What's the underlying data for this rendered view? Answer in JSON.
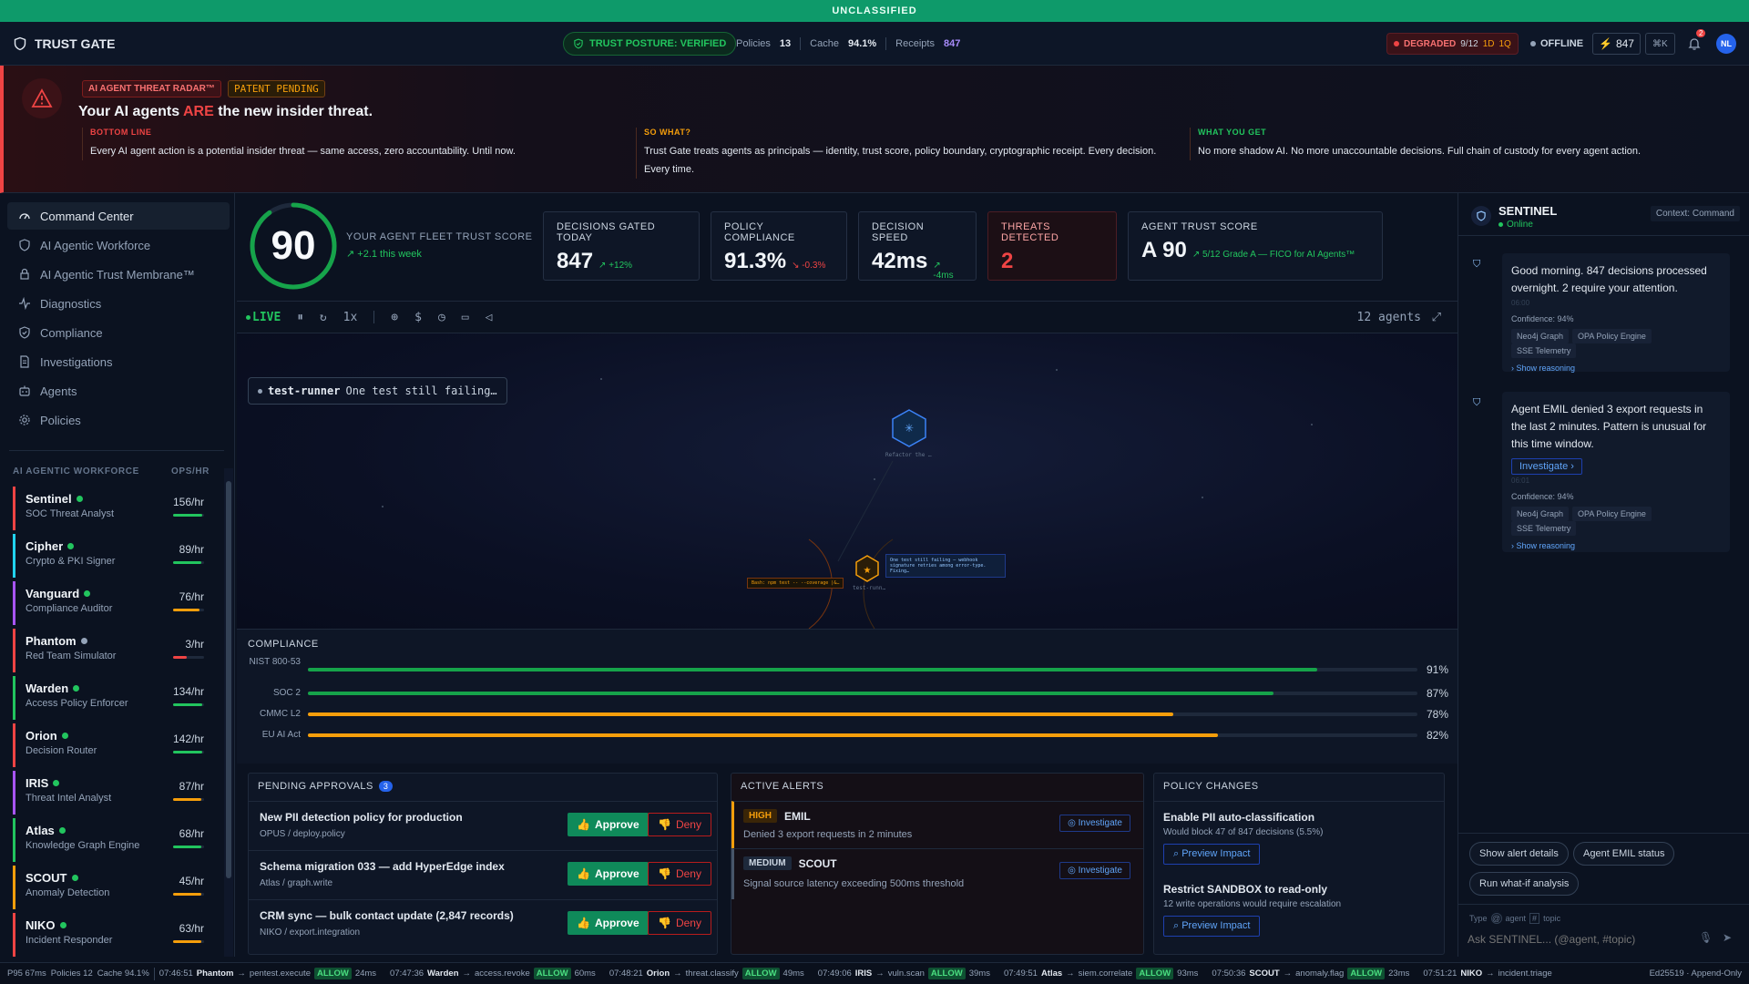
{
  "classification": "UNCLASSIFIED",
  "brand": {
    "name": "TRUST GATE"
  },
  "posture": "TRUST POSTURE: VERIFIED",
  "top_stats": {
    "policies_label": "Policies",
    "policies": "13",
    "cache_label": "Cache",
    "cache": "94.1%",
    "receipts_label": "Receipts",
    "receipts": "847"
  },
  "status": {
    "degraded": "DEGRADED",
    "degraded_count": "9/12",
    "d": "1D",
    "q": "1Q",
    "offline": "OFFLINE",
    "counter": "847",
    "shortcut": "⌘K",
    "notif_count": "2",
    "avatar": "NL"
  },
  "hero": {
    "tag": "AI AGENT THREAT RADAR™",
    "patent": "PATENT PENDING",
    "headline_a": "Your AI agents ",
    "headline_b": "ARE",
    "headline_c": " the new insider threat.",
    "cols": [
      {
        "label": "BOTTOM LINE",
        "text": "Every AI agent action is a potential insider threat — same access, zero accountability. Until now."
      },
      {
        "label": "SO WHAT?",
        "text": "Trust Gate treats agents as principals — identity, trust score, policy boundary, cryptographic receipt. Every decision. Every time."
      },
      {
        "label": "WHAT YOU GET",
        "text": "No more shadow AI. No more unaccountable decisions. Full chain of custody for every agent action."
      }
    ]
  },
  "nav": [
    "Command Center",
    "AI Agentic Workforce",
    "AI Agentic Trust Membrane™",
    "Diagnostics",
    "Compliance",
    "Investigations",
    "Agents",
    "Policies"
  ],
  "workforce": {
    "title": "AI AGENTIC WORKFORCE",
    "unit": "OPS/HR",
    "agents": [
      {
        "name": "Sentinel",
        "role": "SOC Threat Analyst",
        "rate": "156/hr",
        "level": 0.95,
        "accent": "#ef4444",
        "bar": "#22c55e"
      },
      {
        "name": "Cipher",
        "role": "Crypto & PKI Signer",
        "rate": "89/hr",
        "level": 0.9,
        "accent": "#22d3ee",
        "bar": "#22c55e"
      },
      {
        "name": "Vanguard",
        "role": "Compliance Auditor",
        "rate": "76/hr",
        "level": 0.85,
        "accent": "#a855f7",
        "bar": "#f59e0b"
      },
      {
        "name": "Phantom",
        "role": "Red Team Simulator",
        "rate": "3/hr",
        "level": 0.45,
        "accent": "#ef4444",
        "bar": "#ef4444"
      },
      {
        "name": "Warden",
        "role": "Access Policy Enforcer",
        "rate": "134/hr",
        "level": 0.95,
        "accent": "#22c55e",
        "bar": "#22c55e"
      },
      {
        "name": "Orion",
        "role": "Decision Router",
        "rate": "142/hr",
        "level": 0.95,
        "accent": "#ef4444",
        "bar": "#22c55e"
      },
      {
        "name": "IRIS",
        "role": "Threat Intel Analyst",
        "rate": "87/hr",
        "level": 0.9,
        "accent": "#a855f7",
        "bar": "#f59e0b"
      },
      {
        "name": "Atlas",
        "role": "Knowledge Graph Engine",
        "rate": "68/hr",
        "level": 0.9,
        "accent": "#22c55e",
        "bar": "#22c55e"
      },
      {
        "name": "SCOUT",
        "role": "Anomaly Detection",
        "rate": "45/hr",
        "level": 0.9,
        "accent": "#f59e0b",
        "bar": "#f59e0b"
      },
      {
        "name": "NIKO",
        "role": "Incident Responder",
        "rate": "63/hr",
        "level": 0.9,
        "accent": "#ef4444",
        "bar": "#f59e0b"
      }
    ]
  },
  "fleet": {
    "score": "90",
    "score_value": 90,
    "label": "YOUR AGENT FLEET TRUST SCORE",
    "trend": "↗ +2.1 this week"
  },
  "kpis": [
    {
      "label": "DECISIONS GATED TODAY",
      "value": "847",
      "delta": "↗ +12%",
      "tone": "#22c55e"
    },
    {
      "label": "POLICY COMPLIANCE",
      "value": "91.3%",
      "delta": "↘ -0.3%",
      "tone": "#ef4444"
    },
    {
      "label": "DECISION SPEED",
      "value": "42ms",
      "delta": "↗ -4ms",
      "tone": "#22c55e"
    },
    {
      "label": "THREATS DETECTED",
      "value": "2",
      "delta": "",
      "tone": "#ef4444"
    },
    {
      "label": "AGENT TRUST SCORE",
      "value": "A 90",
      "delta": "↗ 5/12 Grade A — FICO for AI Agents™",
      "tone": "#22c55e"
    }
  ],
  "toolbar": {
    "live": "LIVE",
    "speed": "1x",
    "agents": "12 agents"
  },
  "canvas": {
    "toast_agent": "test-runner",
    "toast_text": "One test still failing…",
    "node_top": "Refactor the …",
    "node_bottom": "test-runn…",
    "tip_left": "Bash: npm test -- --coverage |&…",
    "tip_right": "One test still failing — webhook signature retries among error-type. Fixing…"
  },
  "compliance": {
    "title": "COMPLIANCE",
    "rows": [
      {
        "name": "NIST 800-53",
        "value": 91,
        "label": "91%",
        "color": "#16a34a"
      },
      {
        "name": "SOC 2",
        "value": 87,
        "label": "87%",
        "color": "#16a34a"
      },
      {
        "name": "CMMC L2",
        "value": 78,
        "label": "78%",
        "color": "#f59e0b"
      },
      {
        "name": "EU AI Act",
        "value": 82,
        "label": "82%",
        "color": "#f59e0b"
      }
    ]
  },
  "approvals": {
    "title": "PENDING APPROVALS",
    "count": "3",
    "approve": "Approve",
    "deny": "Deny",
    "items": [
      {
        "title": "New PII detection policy for production",
        "sub": "OPUS / deploy.policy"
      },
      {
        "title": "Schema migration 033 — add HyperEdge index",
        "sub": "Atlas / graph.write"
      },
      {
        "title": "CRM sync — bulk contact update (2,847 records)",
        "sub": "NIKO / export.integration"
      }
    ]
  },
  "alerts": {
    "title": "ACTIVE ALERTS",
    "action": "Investigate",
    "items": [
      {
        "sev": "HIGH",
        "agent": "EMIL",
        "text": "Denied 3 export requests in 2 minutes"
      },
      {
        "sev": "MEDIUM",
        "agent": "SCOUT",
        "text": "Signal source latency exceeding 500ms threshold"
      }
    ]
  },
  "policy_changes": {
    "title": "POLICY CHANGES",
    "action": "Preview Impact",
    "items": [
      {
        "title": "Enable PII auto-classification",
        "sub": "Would block 47 of 847 decisions (5.5%)"
      },
      {
        "title": "Restrict SANDBOX to read-only",
        "sub": "12 write operations would require escalation"
      }
    ]
  },
  "sentinel": {
    "name": "SENTINEL",
    "status": "Online",
    "context": "Context: Command",
    "messages": [
      {
        "text": "Good morning. 847 decisions processed overnight. 2 require your attention.",
        "time": "06:00",
        "confidence": "Confidence: 94%",
        "chips": [
          "Neo4j Graph",
          "OPA Policy Engine",
          "SSE Telemetry"
        ],
        "reasoning": "› Show reasoning"
      },
      {
        "text": "Agent EMIL denied 3 export requests in the last 2 minutes. Pattern is unusual for this time window.",
        "action": "Investigate ›",
        "time": "06:01",
        "confidence": "Confidence: 94%",
        "chips": [
          "Neo4j Graph",
          "OPA Policy Engine",
          "SSE Telemetry"
        ],
        "reasoning": "› Show reasoning"
      }
    ],
    "suggestions": [
      "Show alert details",
      "Agent EMIL status",
      "Run what-if analysis"
    ],
    "hint_type": "Type",
    "hint_agent": "agent",
    "hint_topic": "topic",
    "placeholder": "Ask SENTINEL... (@agent, #topic)"
  },
  "footer": {
    "p95": "P95 67ms",
    "policies": "Policies 12",
    "cache": "Cache 94.1%",
    "events": [
      {
        "time": "07:46:51",
        "agent": "Phantom",
        "action": "pentest.execute",
        "verdict": "ALLOW",
        "ms": "24ms"
      },
      {
        "time": "07:47:36",
        "agent": "Warden",
        "action": "access.revoke",
        "verdict": "ALLOW",
        "ms": "60ms"
      },
      {
        "time": "07:48:21",
        "agent": "Orion",
        "action": "threat.classify",
        "verdict": "ALLOW",
        "ms": "49ms"
      },
      {
        "time": "07:49:06",
        "agent": "IRIS",
        "action": "vuln.scan",
        "verdict": "ALLOW",
        "ms": "39ms"
      },
      {
        "time": "07:49:51",
        "agent": "Atlas",
        "action": "siem.correlate",
        "verdict": "ALLOW",
        "ms": "93ms"
      },
      {
        "time": "07:50:36",
        "agent": "SCOUT",
        "action": "anomaly.flag",
        "verdict": "ALLOW",
        "ms": "23ms"
      },
      {
        "time": "07:51:21",
        "agent": "NIKO",
        "action": "incident.triage",
        "verdict": "",
        "ms": ""
      }
    ],
    "sig": "Ed25519 · Append-Only"
  }
}
